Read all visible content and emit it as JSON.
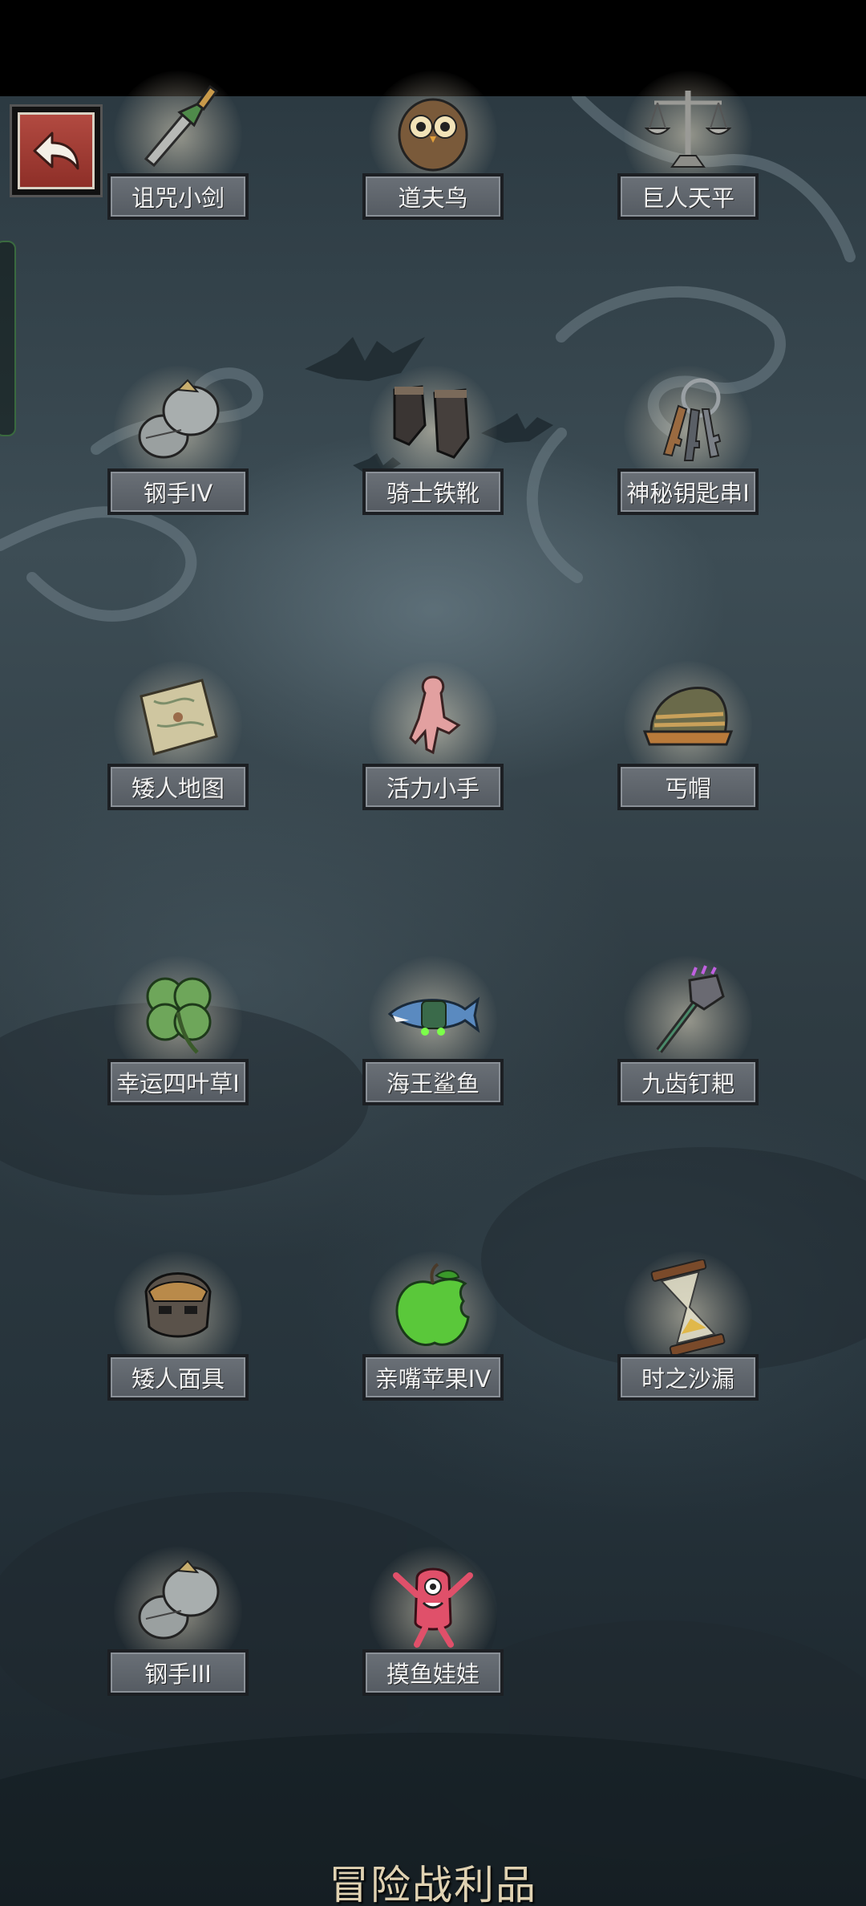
{
  "screen": {
    "title": "冒险战利品"
  },
  "items": [
    {
      "name": "诅咒小剑",
      "icon": "cursed-dagger-icon"
    },
    {
      "name": "道夫鸟",
      "icon": "owl-icon"
    },
    {
      "name": "巨人天平",
      "icon": "scales-icon"
    },
    {
      "name": "钢手IV",
      "icon": "steel-gauntlet-icon"
    },
    {
      "name": "骑士铁靴",
      "icon": "iron-boots-icon"
    },
    {
      "name": "神秘钥匙串I",
      "icon": "key-ring-icon"
    },
    {
      "name": "矮人地图",
      "icon": "map-scroll-icon"
    },
    {
      "name": "活力小手",
      "icon": "small-hand-icon"
    },
    {
      "name": "丐帽",
      "icon": "beggar-hat-icon"
    },
    {
      "name": "幸运四叶草I",
      "icon": "four-leaf-clover-icon"
    },
    {
      "name": "海王鲨鱼",
      "icon": "shark-icon"
    },
    {
      "name": "九齿钉耙",
      "icon": "rake-icon"
    },
    {
      "name": "矮人面具",
      "icon": "dwarf-mask-icon"
    },
    {
      "name": "亲嘴苹果IV",
      "icon": "bitten-apple-icon"
    },
    {
      "name": "时之沙漏",
      "icon": "hourglass-icon"
    },
    {
      "name": "钢手III",
      "icon": "steel-gauntlet-icon"
    },
    {
      "name": "摸鱼娃娃",
      "icon": "pink-doll-icon"
    }
  ],
  "colors": {
    "plate": "#5f656c",
    "title": "#e0d2b2",
    "back_button": "#a3403a"
  }
}
